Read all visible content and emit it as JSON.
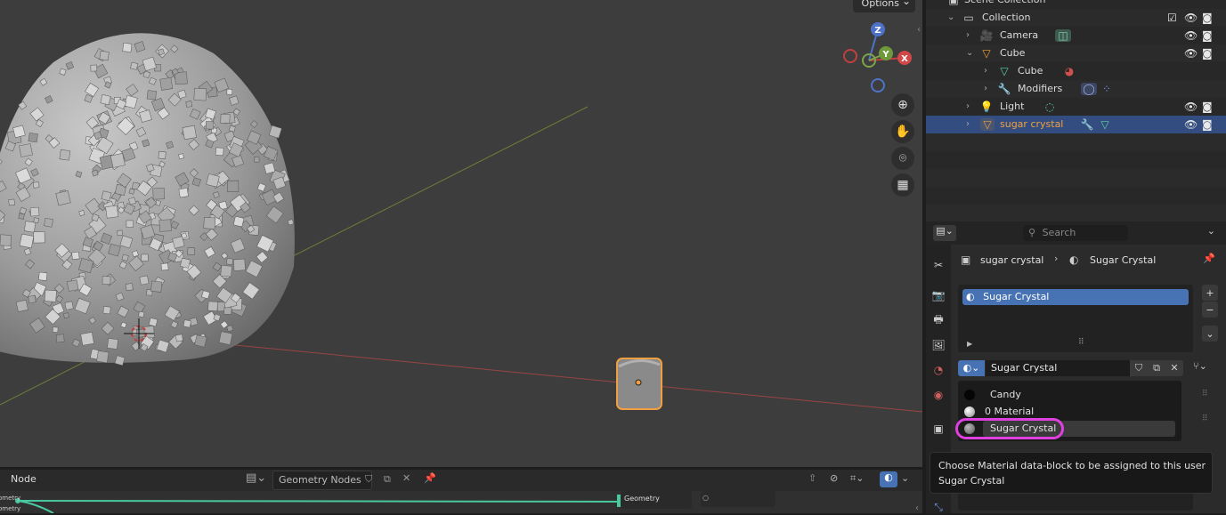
{
  "viewport": {
    "options_label": "Options",
    "gizmo_axes": {
      "z": "Z",
      "y": "Y",
      "x": "X"
    }
  },
  "node_editor": {
    "editor_label": "Node",
    "tree_name": "Geometry Nodes",
    "node_label": "Geometry",
    "socket_left_1": "ometry",
    "socket_left_2": "ometry"
  },
  "outliner": {
    "scene_collection": "Scene Collection",
    "items": [
      {
        "label": "Collection"
      },
      {
        "label": "Camera"
      },
      {
        "label": "Cube"
      },
      {
        "label": "Cube"
      },
      {
        "label": "Modifiers"
      },
      {
        "label": "Light"
      },
      {
        "label": "sugar crystal"
      }
    ]
  },
  "properties": {
    "search_placeholder": "Search",
    "breadcrumb_object": "sugar crystal",
    "breadcrumb_material": "Sugar Crystal",
    "slot_name": "Sugar Crystal",
    "material_field": "Sugar Crystal",
    "dropdown_items": [
      "Candy",
      "0 Material",
      "Sugar Crystal"
    ],
    "tooltip_line1": "Choose Material data-block to be assigned to this user",
    "tooltip_line2": "Sugar Crystal"
  },
  "colors": {
    "accent_selected": "#4772b3",
    "highlight_ring": "#e040e0",
    "object_orange": "#f0a040",
    "axis_red": "#b84040",
    "axis_green": "#7a9a3a"
  }
}
